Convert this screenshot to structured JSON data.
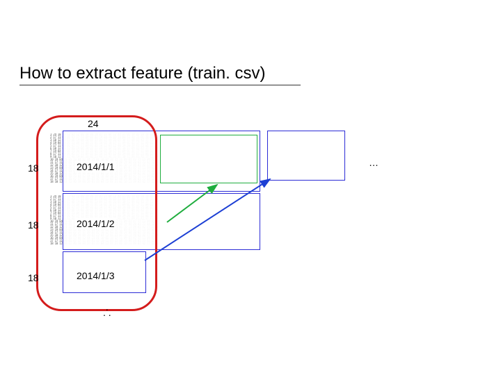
{
  "title": "How to extract feature (train. csv)",
  "top_count": "24",
  "rows_per_block": "18",
  "blocks": [
    {
      "date": "2014/1/1"
    },
    {
      "date": "2014/1/2"
    },
    {
      "date": "2014/1/3"
    }
  ],
  "ellipsis_right": "…",
  "ellipsis_bottom_1": ".",
  "ellipsis_bottom_2": ". ."
}
